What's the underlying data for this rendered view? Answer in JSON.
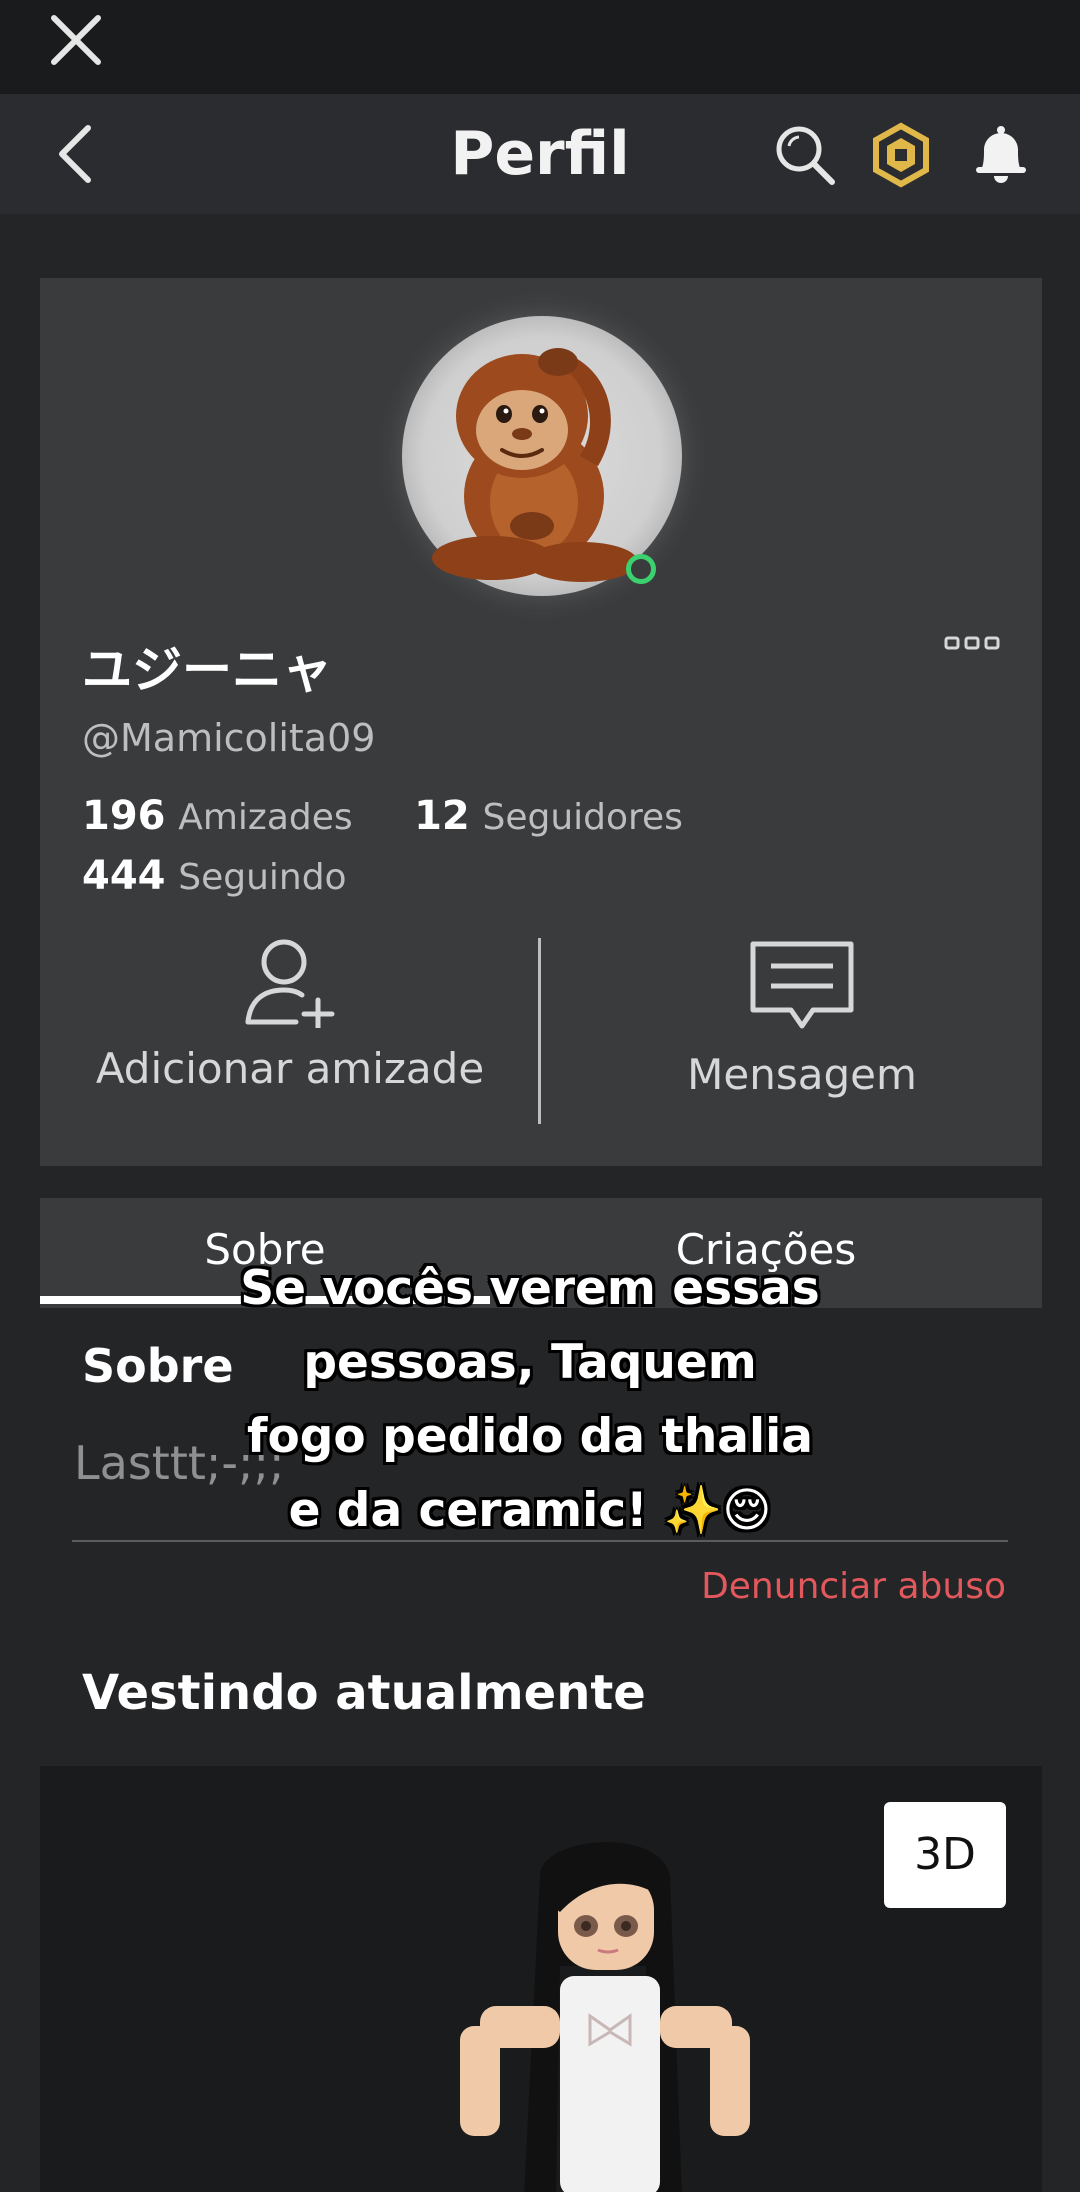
{
  "header": {
    "title": "Perfil",
    "icons": [
      "close-icon",
      "back-icon",
      "search-icon",
      "robux-icon",
      "bell-icon"
    ]
  },
  "profile": {
    "display_name": "ユジーニャ",
    "username": "@Mamicolita09",
    "stats": {
      "friends_count": "196",
      "friends_label": "Amizades",
      "followers_count": "12",
      "followers_label": "Seguidores",
      "following_count": "444",
      "following_label": "Seguindo"
    },
    "actions": {
      "add_friend": "Adicionar amizade",
      "message": "Mensagem"
    },
    "online": true
  },
  "tabs": [
    {
      "label": "Sobre",
      "active": true
    },
    {
      "label": "Criações",
      "active": false
    }
  ],
  "about": {
    "title": "Sobre",
    "text": "Lasttt;-;;;",
    "report": "Denunciar abuso"
  },
  "wearing": {
    "title": "Vestindo atualmente",
    "button_3d": "3D"
  },
  "caption": {
    "lines": [
      "Se vocês verem essas",
      "pessoas, Taquem",
      "fogo pedido da thalia",
      "e da ceramic! ✨😌"
    ]
  },
  "colors": {
    "background": "#232527",
    "card": "#393b3d",
    "report": "#e2585c",
    "online": "#3bd16f"
  }
}
